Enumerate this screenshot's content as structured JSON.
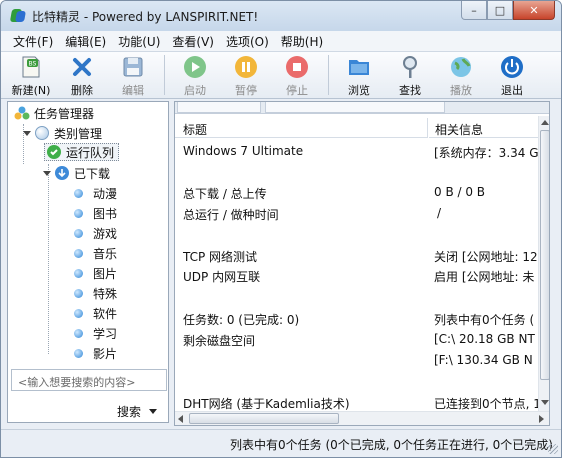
{
  "window": {
    "title": "比特精灵 - Powered by LANSPIRIT.NET!",
    "buttons": {
      "minimize": "–",
      "maximize": "□",
      "close": "✕"
    }
  },
  "menu": [
    "文件(F)",
    "编辑(E)",
    "功能(U)",
    "查看(V)",
    "选项(O)",
    "帮助(H)"
  ],
  "toolbar": {
    "new": "新建(N)",
    "delete": "删除",
    "edit": "编辑",
    "start": "启动",
    "pause": "暂停",
    "stop": "停止",
    "browse": "浏览",
    "find": "查找",
    "play": "播放",
    "exit": "退出"
  },
  "tree": {
    "root": "任务管理器",
    "category": "类别管理",
    "running": "运行队列",
    "downloaded": "已下载",
    "items": [
      "动漫",
      "图书",
      "游戏",
      "音乐",
      "图片",
      "特殊",
      "软件",
      "学习",
      "影片"
    ]
  },
  "search": {
    "placeholder": "<输入想要搜索的内容>",
    "button": "搜索"
  },
  "table": {
    "col_title": "标题",
    "col_info": "相关信息",
    "rows": [
      {
        "title": "Windows 7 Ultimate",
        "info": "[系统内存：3.34 G"
      },
      {
        "title": "总下载 / 总上传",
        "info": "0 B / 0 B"
      },
      {
        "title": "总运行 / 做种时间",
        "info": "/"
      },
      {
        "title": "TCP 网络测试",
        "info": "关闭 [公网地址: 12"
      },
      {
        "title": "UDP 内网互联",
        "info": "启用 [公网地址: 未"
      },
      {
        "title": "任务数: 0 (已完成: 0)",
        "info": "列表中有0个任务 ("
      },
      {
        "title": "剩余磁盘空间",
        "info": "[C:\\ 20.18 GB  NT"
      },
      {
        "title": "",
        "info": "[F:\\ 130.34 GB  N"
      },
      {
        "title": "DHT网络 (基于Kademlia技术)",
        "info": "已连接到0个节点, 1"
      }
    ]
  },
  "status": "列表中有0个任务 (0个已完成, 0个任务正在进行, 0个已完成)"
}
